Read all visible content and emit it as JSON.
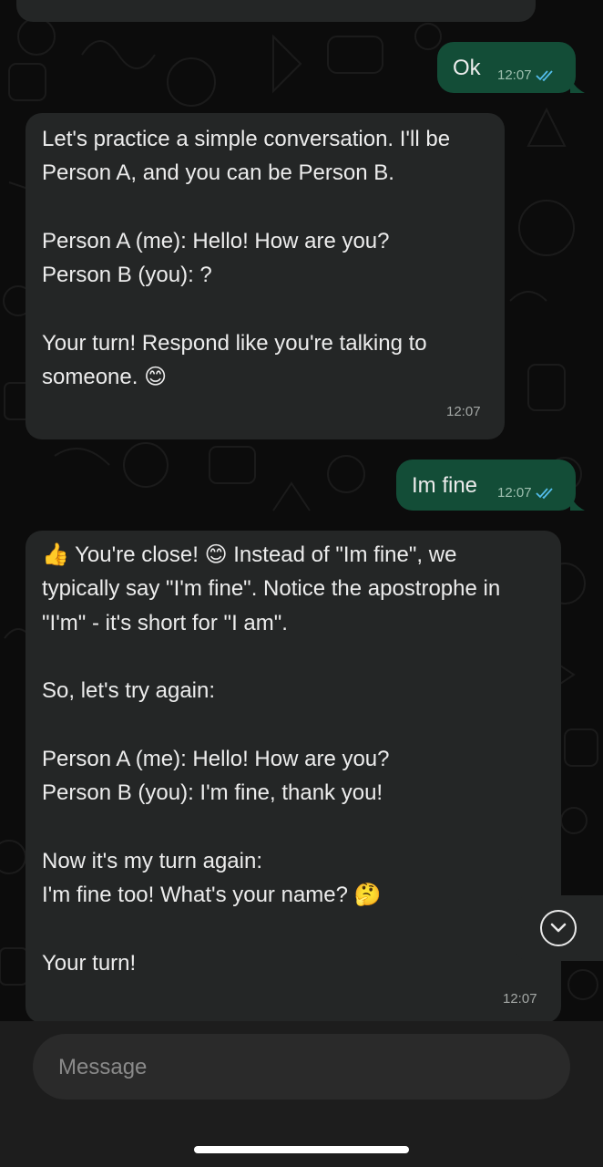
{
  "messages": [
    {
      "id": "m0",
      "side": "in",
      "text": "",
      "time": ""
    },
    {
      "id": "m1",
      "side": "out",
      "text": "Ok",
      "time": "12:07",
      "read": true
    },
    {
      "id": "m2",
      "side": "in",
      "text": "Let's practice a simple conversation. I'll be\nPerson A, and you can be Person B.\n\nPerson A (me): Hello! How are you?\nPerson B (you): ?\n\nYour turn! Respond like you're talking to\nsomeone. 😊",
      "time": "12:07"
    },
    {
      "id": "m3",
      "side": "out",
      "text": "Im fine",
      "time": "12:07",
      "read": true
    },
    {
      "id": "m4",
      "side": "in",
      "text": "👍 You're close! 😊 Instead of \"Im fine\", we\ntypically say \"I'm fine\". Notice the apostrophe in\n\"I'm\" - it's short for \"I am\".\n\nSo, let's try again:\n\nPerson A (me): Hello! How are you?\nPerson B (you): I'm fine, thank you!\n\nNow it's my turn again:\nI'm fine too! What's your name? 🤔\n\nYour turn!",
      "time": "12:07"
    }
  ],
  "composer": {
    "placeholder": "Message"
  },
  "icons": {
    "read_ticks": "double-check-icon",
    "scroll_down": "chevron-down-icon"
  },
  "colors": {
    "incoming_bubble": "#242626",
    "outgoing_bubble": "#134d37",
    "read_tick": "#53bdeb",
    "background": "#0c0c0c"
  }
}
